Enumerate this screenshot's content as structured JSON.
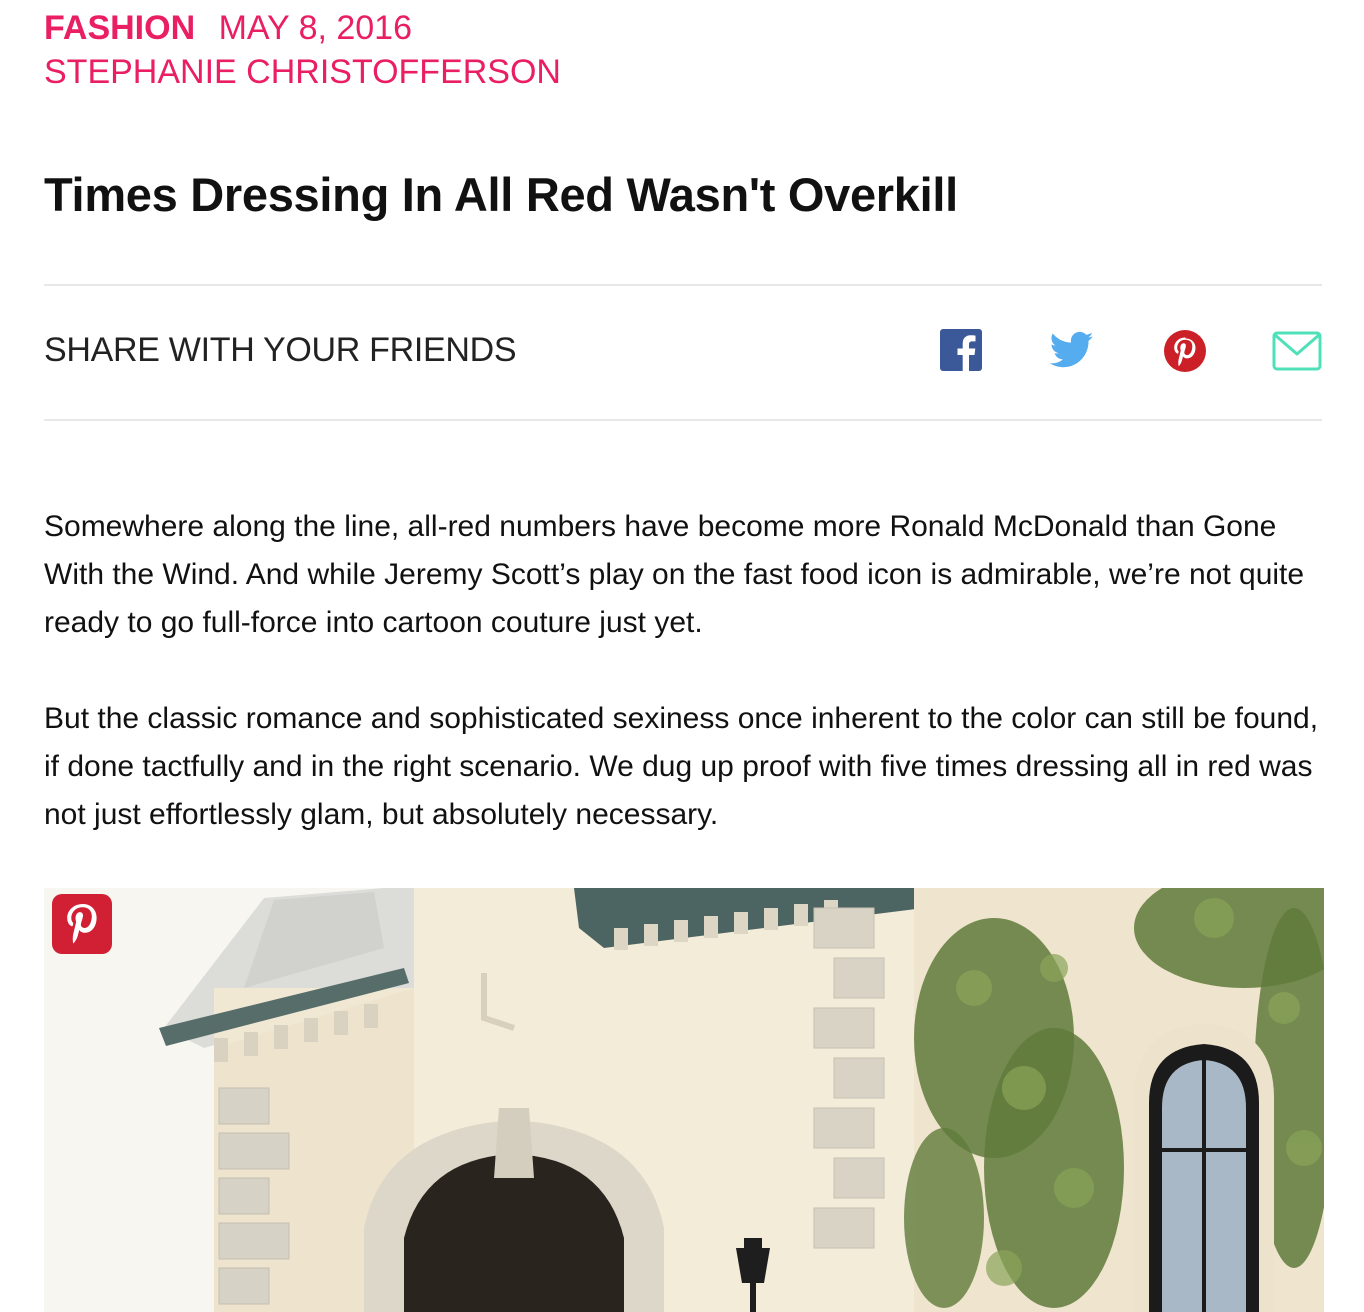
{
  "article": {
    "category": "FASHION",
    "date": "MAY 8, 2016",
    "author": "STEPHANIE CHRISTOFFERSON",
    "title": "Times Dressing In All Red Wasn't Overkill",
    "paragraphs": [
      "Somewhere along the line, all-red numbers have become more Ronald McDonald than Gone With the Wind. And while Jeremy Scott’s play on the fast food icon is admirable, we’re not quite ready to go full-force into cartoon couture just yet.",
      "But the classic romance and sophisticated sexiness once inherent to the color can still be found, if done tactfully and in the right scenario. We dug up proof with five times dressing all in red was not just effortlessly glam, but absolutely necessary."
    ]
  },
  "share": {
    "label": "SHARE WITH YOUR FRIENDS",
    "icons": [
      {
        "name": "facebook-icon",
        "color": "#3b5998"
      },
      {
        "name": "twitter-icon",
        "color": "#55acee"
      },
      {
        "name": "pinterest-icon",
        "color": "#cb2027"
      },
      {
        "name": "email-icon",
        "color": "#4ee0b8"
      }
    ]
  },
  "image": {
    "save_icon": "pinterest-save-icon",
    "save_color": "#d11f33"
  },
  "colors": {
    "accent": "#e91e63"
  }
}
